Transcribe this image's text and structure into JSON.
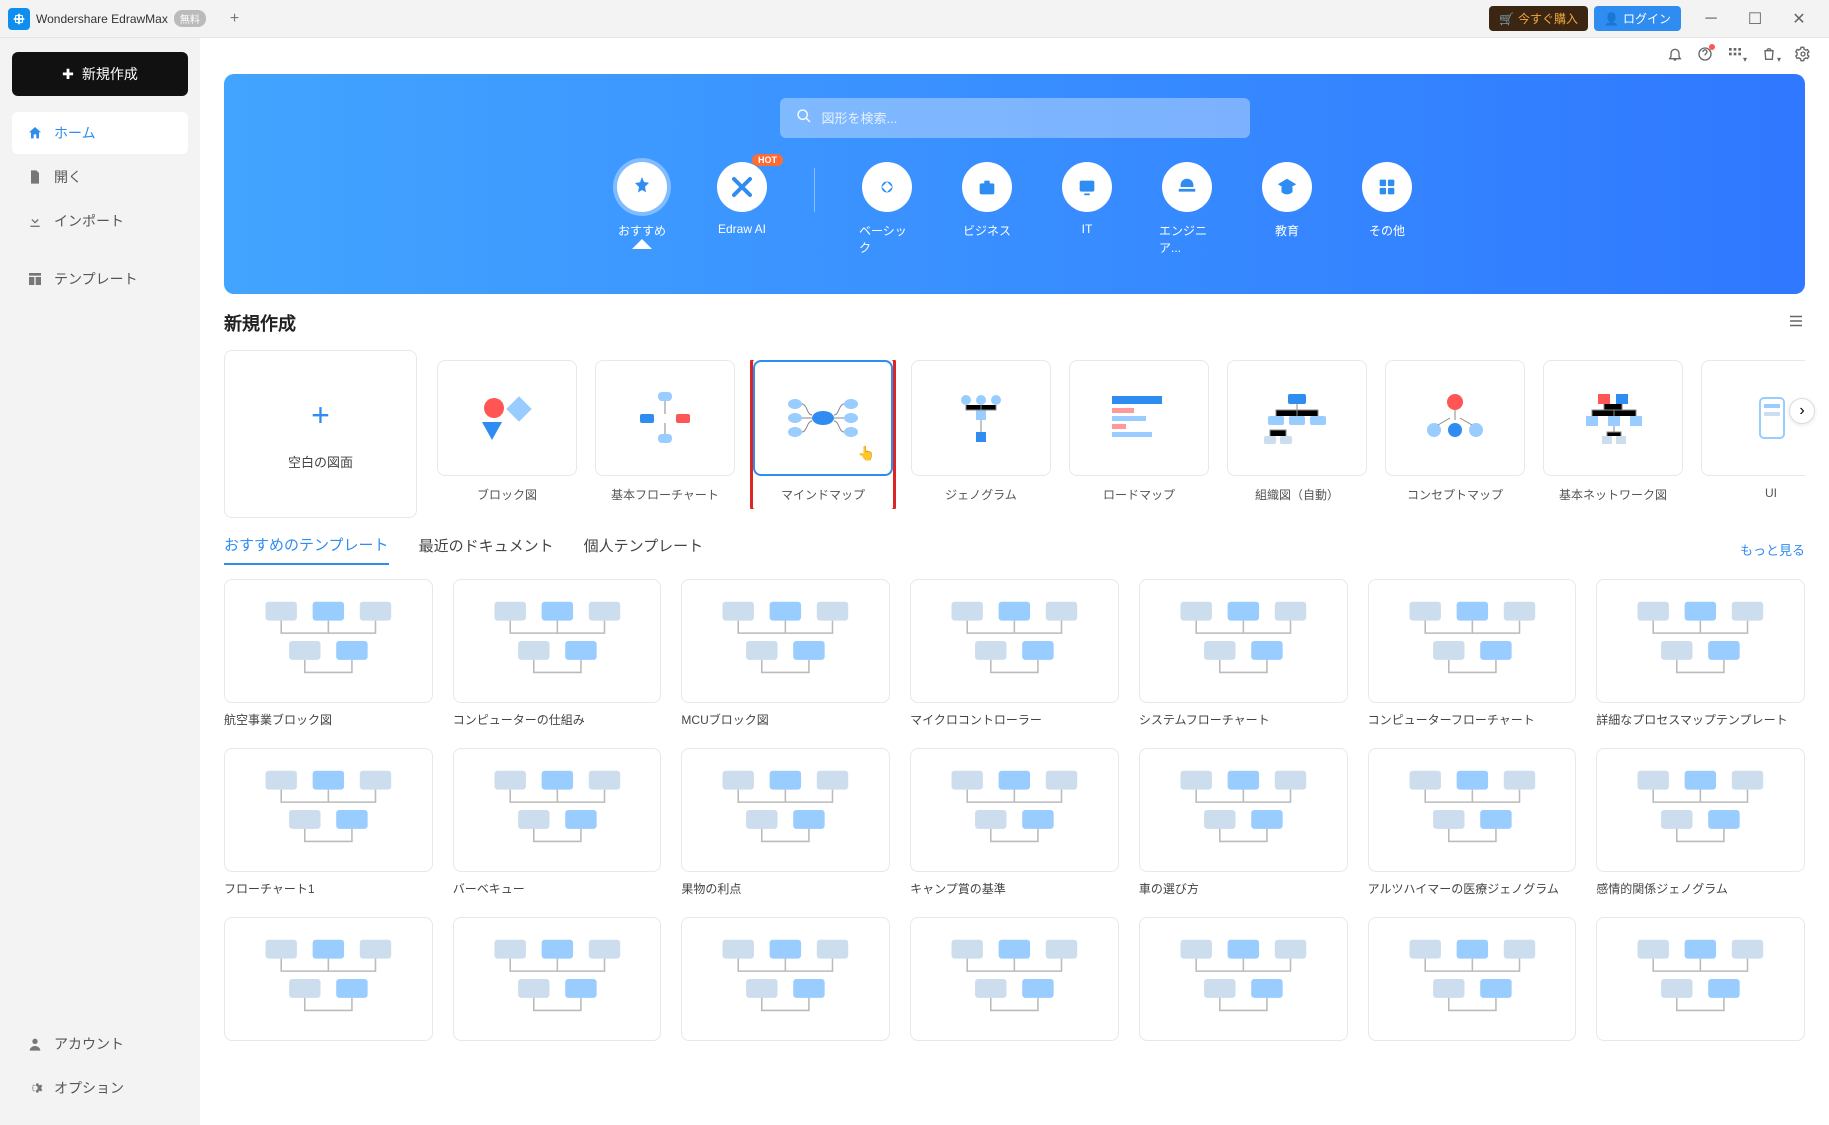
{
  "app": {
    "name": "Wondershare EdrawMax",
    "free_badge": "無料"
  },
  "titlebar": {
    "buy_now": "今すぐ購入",
    "login": "ログイン"
  },
  "sidebar": {
    "new_btn": "新規作成",
    "items": [
      {
        "label": "ホーム",
        "icon": "home"
      },
      {
        "label": "開く",
        "icon": "file"
      },
      {
        "label": "インポート",
        "icon": "import"
      },
      {
        "label": "テンプレート",
        "icon": "template"
      }
    ],
    "bottom": [
      {
        "label": "アカウント",
        "icon": "user"
      },
      {
        "label": "オプション",
        "icon": "gear"
      }
    ]
  },
  "hero": {
    "search_placeholder": "図形を検索...",
    "categories": [
      {
        "label": "おすすめ",
        "active": true
      },
      {
        "label": "Edraw AI",
        "hot": true
      },
      {
        "label": "ベーシック"
      },
      {
        "label": "ビジネス"
      },
      {
        "label": "IT"
      },
      {
        "label": "エンジニア..."
      },
      {
        "label": "教育"
      },
      {
        "label": "その他"
      }
    ]
  },
  "new_section": {
    "title": "新規作成",
    "blank": "空白の図面",
    "templates": [
      "ブロック図",
      "基本フローチャート",
      "マインドマップ",
      "ジェノグラム",
      "ロードマップ",
      "組織図（自動）",
      "コンセプトマップ",
      "基本ネットワーク図",
      "UI"
    ],
    "highlight_index": 2
  },
  "tabs": {
    "items": [
      "おすすめのテンプレート",
      "最近のドキュメント",
      "個人テンプレート"
    ],
    "see_all": "もっと見る"
  },
  "grid_templates": [
    "航空事業ブロック図",
    "コンピューターの仕組み",
    "MCUブロック図",
    "マイクロコントローラー",
    "システムフローチャート",
    "コンピューターフローチャート",
    "詳細なプロセスマップテンプレート",
    "フローチャート1",
    "バーベキュー",
    "果物の利点",
    "キャンプ賞の基準",
    "車の選び方",
    "アルツハイマーの医療ジェノグラム",
    "感情的関係ジェノグラム",
    "",
    "",
    "",
    "",
    "",
    "",
    ""
  ]
}
